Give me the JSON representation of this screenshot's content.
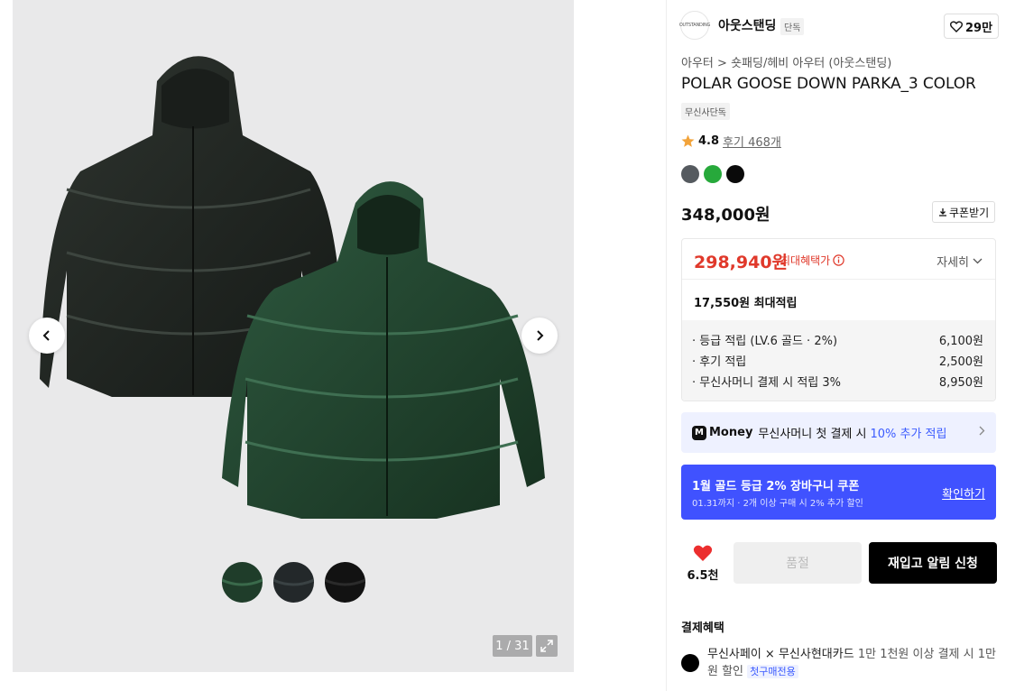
{
  "gallery": {
    "counter": "1 / 31",
    "thumbnails": [
      "green",
      "dark-green",
      "black"
    ]
  },
  "brand": {
    "logo_text": "OUTSTANDING",
    "name": "아웃스탠딩",
    "tag": "단독",
    "likes": "29만"
  },
  "product": {
    "breadcrumb_1": "아우터",
    "breadcrumb_sep": ">",
    "breadcrumb_2": "숏패딩/헤비 아우터 (아웃스탠딩)",
    "title": "POLAR GOOSE DOWN PARKA_3 COLOR",
    "exclusive_tag": "무신사단독",
    "rating": "4.8",
    "reviews": "후기 468개",
    "colors": [
      "#555a5f",
      "#27a93b",
      "#0a0a0a"
    ],
    "price": "348,000원",
    "coupon_label": "쿠폰받기"
  },
  "benefits": {
    "sale_price": "298,940원",
    "sale_label": "최대혜택가",
    "detail_toggle": "자세히",
    "max_points": "17,550원 최대적립",
    "items": [
      {
        "label": "· 등급 적립 (LV.6 골드 · 2%)",
        "value": "6,100원"
      },
      {
        "label": "· 후기 적립",
        "value": "2,500원"
      },
      {
        "label": "· 무신사머니 결제 시 적립 3%",
        "value": "8,950원"
      }
    ]
  },
  "money_banner": {
    "logo": "Money",
    "text": "무신사머니 첫 결제 시",
    "accent": "10% 추가 적립"
  },
  "gold_banner": {
    "title": "1월 골드 등급 2% 장바구니 쿠폰",
    "sub": "01.31까지 · 2개 이상 구매 시 2% 추가 할인",
    "link": "확인하기"
  },
  "actions": {
    "wish_count": "6.5천",
    "soldout": "품절",
    "restock": "재입고 알림 신청"
  },
  "payment": {
    "title": "결제혜택",
    "name": "무신사페이 × 무신사현대카드",
    "desc": "1만 1천원 이상 결제 시 1만원 할인",
    "badge": "첫구매전용"
  }
}
